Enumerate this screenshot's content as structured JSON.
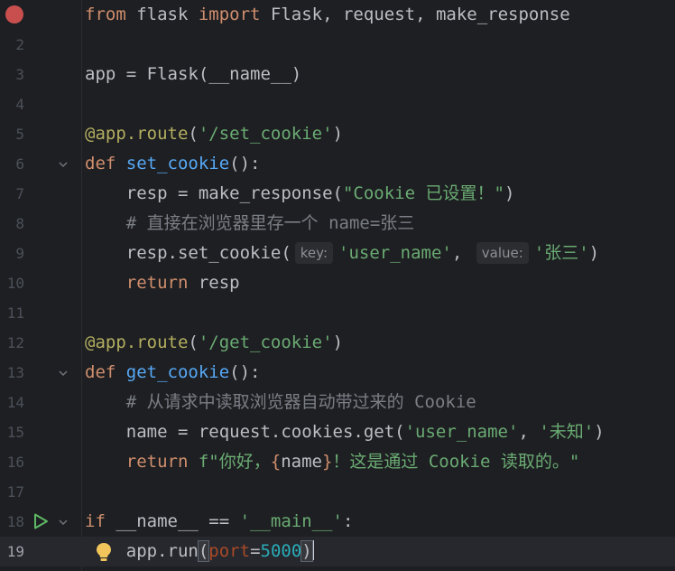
{
  "editor": {
    "lines": [
      {
        "no": "1",
        "tokens": [
          {
            "t": "from",
            "c": "kw"
          },
          {
            "t": " flask ",
            "c": ""
          },
          {
            "t": "import",
            "c": "kw"
          },
          {
            "t": " Flask, request, make_response",
            "c": ""
          }
        ]
      },
      {
        "no": "2",
        "tokens": []
      },
      {
        "no": "3",
        "tokens": [
          {
            "t": "app = Flask(__name__)",
            "c": ""
          }
        ]
      },
      {
        "no": "4",
        "tokens": []
      },
      {
        "no": "5",
        "tokens": [
          {
            "t": "@app.route",
            "c": "dec"
          },
          {
            "t": "(",
            "c": ""
          },
          {
            "t": "'/set_cookie'",
            "c": "str"
          },
          {
            "t": ")",
            "c": ""
          }
        ]
      },
      {
        "no": "6",
        "tokens": [
          {
            "t": "def",
            "c": "kw"
          },
          {
            "t": " ",
            "c": ""
          },
          {
            "t": "set_cookie",
            "c": "fn"
          },
          {
            "t": "():",
            "c": ""
          }
        ]
      },
      {
        "no": "7",
        "tokens": [
          {
            "t": "    resp = make_response(",
            "c": ""
          },
          {
            "t": "\"Cookie 已设置！\"",
            "c": "str"
          },
          {
            "t": ")",
            "c": ""
          }
        ]
      },
      {
        "no": "8",
        "tokens": [
          {
            "t": "    # 直接在浏览器里存一个 name=张三",
            "c": "cmt"
          }
        ]
      },
      {
        "no": "9",
        "tokens": [
          {
            "t": "    resp.set_cookie(",
            "c": ""
          },
          {
            "t": "key:",
            "c": "hint"
          },
          {
            "t": "'user_name'",
            "c": "str"
          },
          {
            "t": ", ",
            "c": ""
          },
          {
            "t": "value:",
            "c": "hint"
          },
          {
            "t": "'张三'",
            "c": "str"
          },
          {
            "t": ")",
            "c": ""
          }
        ]
      },
      {
        "no": "10",
        "tokens": [
          {
            "t": "    ",
            "c": ""
          },
          {
            "t": "return",
            "c": "kw"
          },
          {
            "t": " resp",
            "c": ""
          }
        ]
      },
      {
        "no": "11",
        "tokens": []
      },
      {
        "no": "12",
        "tokens": [
          {
            "t": "@app.route",
            "c": "dec"
          },
          {
            "t": "(",
            "c": ""
          },
          {
            "t": "'/get_cookie'",
            "c": "str"
          },
          {
            "t": ")",
            "c": ""
          }
        ]
      },
      {
        "no": "13",
        "tokens": [
          {
            "t": "def",
            "c": "kw"
          },
          {
            "t": " ",
            "c": ""
          },
          {
            "t": "get_cookie",
            "c": "fn"
          },
          {
            "t": "():",
            "c": ""
          }
        ]
      },
      {
        "no": "14",
        "tokens": [
          {
            "t": "    # 从请求中读取浏览器自动带过来的 Cookie",
            "c": "cmt"
          }
        ]
      },
      {
        "no": "15",
        "tokens": [
          {
            "t": "    name = request.cookies.get(",
            "c": ""
          },
          {
            "t": "'user_name'",
            "c": "str"
          },
          {
            "t": ", ",
            "c": ""
          },
          {
            "t": "'未知'",
            "c": "str"
          },
          {
            "t": ")",
            "c": ""
          }
        ]
      },
      {
        "no": "16",
        "tokens": [
          {
            "t": "    ",
            "c": ""
          },
          {
            "t": "return",
            "c": "kw"
          },
          {
            "t": " ",
            "c": ""
          },
          {
            "t": "f\"你好，",
            "c": "str"
          },
          {
            "t": "{",
            "c": "fmt"
          },
          {
            "t": "name",
            "c": ""
          },
          {
            "t": "}",
            "c": "fmt"
          },
          {
            "t": "！这是通过 Cookie 读取的。\"",
            "c": "str"
          }
        ]
      },
      {
        "no": "17",
        "tokens": []
      },
      {
        "no": "18",
        "tokens": [
          {
            "t": "if",
            "c": "kw"
          },
          {
            "t": " __name__ == ",
            "c": ""
          },
          {
            "t": "'__main__'",
            "c": "str"
          },
          {
            "t": ":",
            "c": ""
          }
        ]
      },
      {
        "no": "19",
        "tokens": [
          {
            "t": "    app.run",
            "c": ""
          },
          {
            "t": "(",
            "c": "brace-hl"
          },
          {
            "t": "port",
            "c": "param"
          },
          {
            "t": "=",
            "c": ""
          },
          {
            "t": "5000",
            "c": "num"
          },
          {
            "t": ")",
            "c": "brace-hl"
          }
        ]
      }
    ],
    "current_line": 19,
    "breakpoint_line": 1,
    "run_line": 18,
    "fold_lines": [
      6,
      13,
      18
    ],
    "bulb_line": 19,
    "colors": {
      "background": "#1e1f22",
      "keyword": "#cf8e6d",
      "function": "#56a8f5",
      "string": "#6aab73",
      "decorator": "#b3ae60",
      "comment": "#7a7e85",
      "number": "#2aacb8",
      "parameter": "#aa4926",
      "breakpoint": "#c94f4f",
      "run": "#5fb865"
    },
    "icons": {
      "breakpoint": "breakpoint-icon",
      "run": "run-icon",
      "fold": "fold-chevron-icon",
      "bulb": "lightbulb-icon"
    }
  }
}
